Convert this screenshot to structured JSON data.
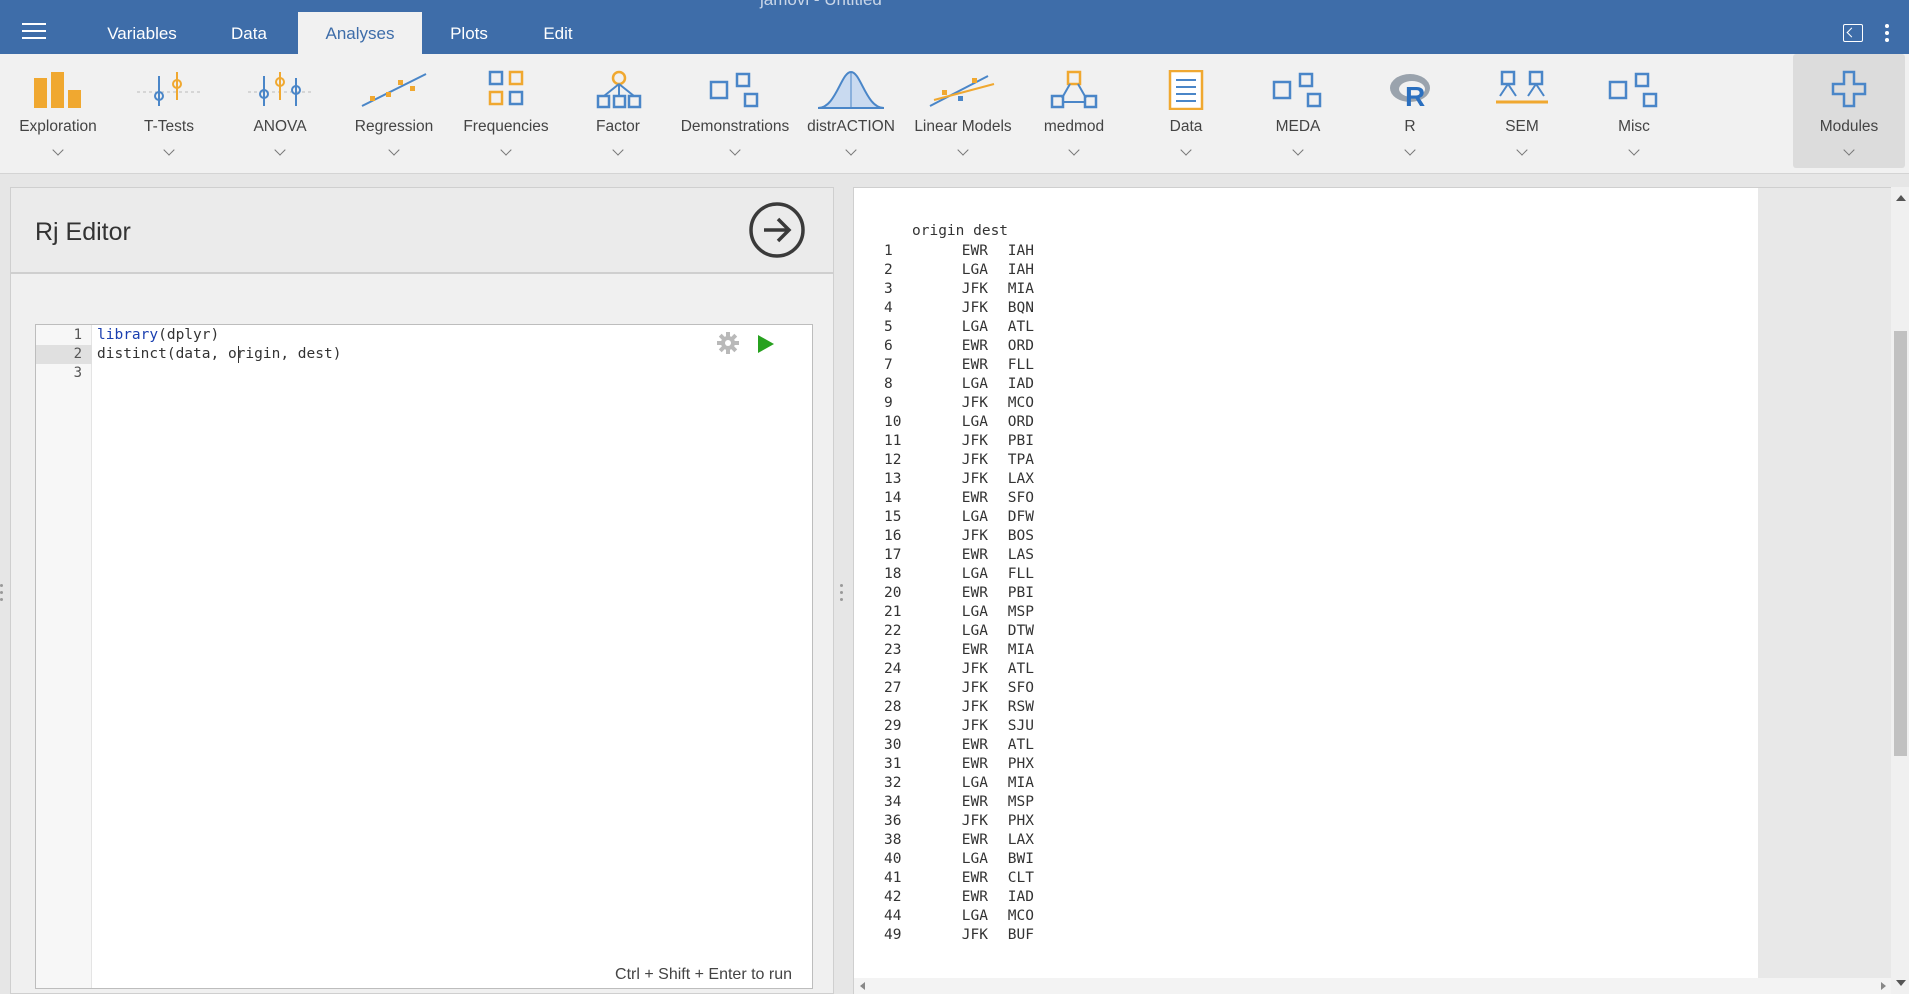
{
  "window": {
    "title": "jamovi - Untitled"
  },
  "topbar": {
    "tabs": [
      {
        "label": "Variables",
        "active": false
      },
      {
        "label": "Data",
        "active": false
      },
      {
        "label": "Analyses",
        "active": true
      },
      {
        "label": "Plots",
        "active": false
      },
      {
        "label": "Edit",
        "active": false
      }
    ]
  },
  "ribbon": {
    "items": [
      {
        "label": "Exploration",
        "icon": "exploration-bar-icon"
      },
      {
        "label": "T-Tests",
        "icon": "ttest-icon"
      },
      {
        "label": "ANOVA",
        "icon": "anova-icon"
      },
      {
        "label": "Regression",
        "icon": "regression-icon"
      },
      {
        "label": "Frequencies",
        "icon": "frequencies-icon"
      },
      {
        "label": "Factor",
        "icon": "factor-icon"
      },
      {
        "label": "Demonstrations",
        "icon": "demonstrations-icon"
      },
      {
        "label": "distrACTION",
        "icon": "distribution-curve-icon"
      },
      {
        "label": "Linear Models",
        "icon": "linear-models-icon"
      },
      {
        "label": "medmod",
        "icon": "medmod-icon"
      },
      {
        "label": "Data",
        "icon": "data-sheet-icon"
      },
      {
        "label": "MEDA",
        "icon": "meda-icon"
      },
      {
        "label": "R",
        "icon": "r-logo-icon"
      },
      {
        "label": "SEM",
        "icon": "sem-icon"
      },
      {
        "label": "Misc",
        "icon": "misc-icon"
      },
      {
        "label": "Modules",
        "icon": "plus-icon"
      }
    ]
  },
  "editor": {
    "title": "Rj Editor",
    "line_numbers": [
      "1",
      "2",
      "3"
    ],
    "current_line": 2,
    "shortcut_hint": "Ctrl + Shift + Enter to run"
  },
  "results": {
    "header": "origin dest",
    "rows": [
      {
        "n": "1",
        "origin": "EWR",
        "dest": "IAH"
      },
      {
        "n": "2",
        "origin": "LGA",
        "dest": "IAH"
      },
      {
        "n": "3",
        "origin": "JFK",
        "dest": "MIA"
      },
      {
        "n": "4",
        "origin": "JFK",
        "dest": "BQN"
      },
      {
        "n": "5",
        "origin": "LGA",
        "dest": "ATL"
      },
      {
        "n": "6",
        "origin": "EWR",
        "dest": "ORD"
      },
      {
        "n": "7",
        "origin": "EWR",
        "dest": "FLL"
      },
      {
        "n": "8",
        "origin": "LGA",
        "dest": "IAD"
      },
      {
        "n": "9",
        "origin": "JFK",
        "dest": "MCO"
      },
      {
        "n": "10",
        "origin": "LGA",
        "dest": "ORD"
      },
      {
        "n": "11",
        "origin": "JFK",
        "dest": "PBI"
      },
      {
        "n": "12",
        "origin": "JFK",
        "dest": "TPA"
      },
      {
        "n": "13",
        "origin": "JFK",
        "dest": "LAX"
      },
      {
        "n": "14",
        "origin": "EWR",
        "dest": "SFO"
      },
      {
        "n": "15",
        "origin": "LGA",
        "dest": "DFW"
      },
      {
        "n": "16",
        "origin": "JFK",
        "dest": "BOS"
      },
      {
        "n": "17",
        "origin": "EWR",
        "dest": "LAS"
      },
      {
        "n": "18",
        "origin": "LGA",
        "dest": "FLL"
      },
      {
        "n": "20",
        "origin": "EWR",
        "dest": "PBI"
      },
      {
        "n": "21",
        "origin": "LGA",
        "dest": "MSP"
      },
      {
        "n": "22",
        "origin": "LGA",
        "dest": "DTW"
      },
      {
        "n": "23",
        "origin": "EWR",
        "dest": "MIA"
      },
      {
        "n": "24",
        "origin": "JFK",
        "dest": "ATL"
      },
      {
        "n": "27",
        "origin": "JFK",
        "dest": "SFO"
      },
      {
        "n": "28",
        "origin": "JFK",
        "dest": "RSW"
      },
      {
        "n": "29",
        "origin": "JFK",
        "dest": "SJU"
      },
      {
        "n": "30",
        "origin": "EWR",
        "dest": "ATL"
      },
      {
        "n": "31",
        "origin": "EWR",
        "dest": "PHX"
      },
      {
        "n": "32",
        "origin": "LGA",
        "dest": "MIA"
      },
      {
        "n": "34",
        "origin": "EWR",
        "dest": "MSP"
      },
      {
        "n": "36",
        "origin": "JFK",
        "dest": "PHX"
      },
      {
        "n": "38",
        "origin": "EWR",
        "dest": "LAX"
      },
      {
        "n": "40",
        "origin": "LGA",
        "dest": "BWI"
      },
      {
        "n": "41",
        "origin": "EWR",
        "dest": "CLT"
      },
      {
        "n": "42",
        "origin": "EWR",
        "dest": "IAD"
      },
      {
        "n": "44",
        "origin": "LGA",
        "dest": "MCO"
      },
      {
        "n": "49",
        "origin": "JFK",
        "dest": "BUF"
      }
    ]
  },
  "colors": {
    "topbar": "#3e6da9",
    "ribbon_icon_orange": "#f0a830",
    "ribbon_icon_blue": "#4a86c8",
    "run_green": "#27a11f"
  }
}
